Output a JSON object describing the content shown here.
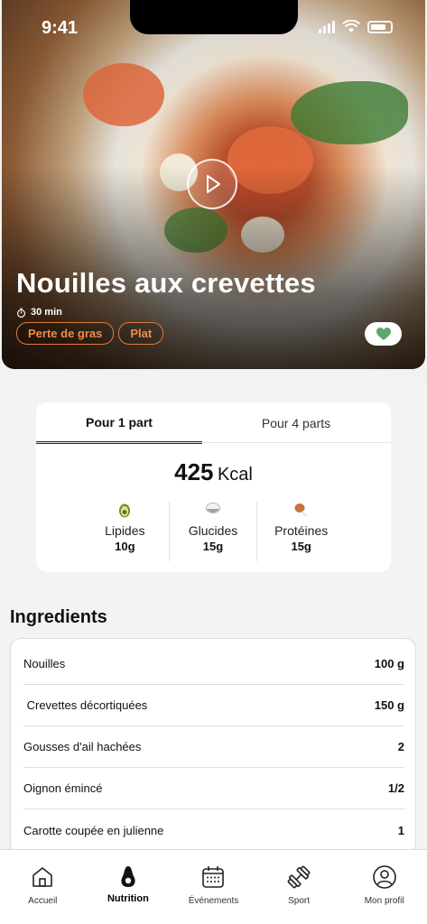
{
  "status_bar": {
    "time": "9:41"
  },
  "recipe": {
    "title": "Nouilles aux crevettes",
    "duration": "30 min",
    "tags": [
      "Perte de gras",
      "Plat"
    ],
    "favorite": true
  },
  "nutrition": {
    "tabs": [
      "Pour 1 part",
      "Pour 4 parts"
    ],
    "active_tab": "Pour 1 part",
    "calories": "425",
    "calories_unit": "Kcal",
    "macros": [
      {
        "icon": "avocado-icon",
        "label": "Lipides",
        "value": "10g"
      },
      {
        "icon": "rice-icon",
        "label": "Glucides",
        "value": "15g"
      },
      {
        "icon": "drumstick-icon",
        "label": "Protéines",
        "value": "15g"
      }
    ]
  },
  "ingredients": {
    "title": "Ingredients",
    "items": [
      {
        "name": "Nouilles",
        "quantity": "100 g"
      },
      {
        "name": " Crevettes décortiquées",
        "quantity": "150 g"
      },
      {
        "name": "Gousses d'ail hachées",
        "quantity": "2"
      },
      {
        "name": "Oignon émincé",
        "quantity": "1/2"
      },
      {
        "name": "Carotte coupée en julienne",
        "quantity": "1"
      }
    ]
  },
  "bottom_nav": {
    "items": [
      {
        "label": "Accueil",
        "icon": "home-icon"
      },
      {
        "label": "Nutrition",
        "icon": "avocado-icon",
        "active": true
      },
      {
        "label": "Événements",
        "icon": "calendar-icon"
      },
      {
        "label": "Sport",
        "icon": "dumbbell-icon"
      },
      {
        "label": "Mon profil",
        "icon": "profile-icon"
      }
    ]
  },
  "colors": {
    "accent": "#e27a3a",
    "heart": "#5fa86a",
    "tab_indicator": "#1f2e26"
  }
}
